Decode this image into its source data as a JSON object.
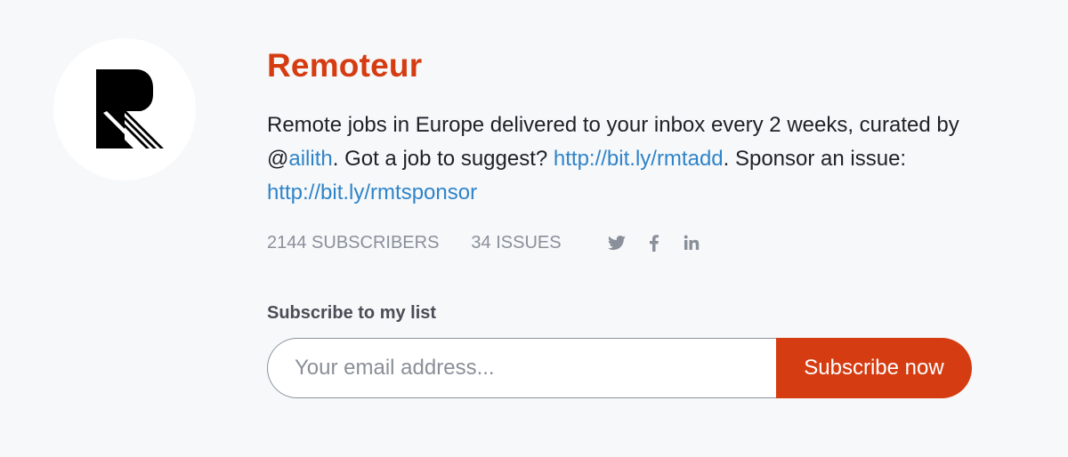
{
  "profile": {
    "name": "Remoteur",
    "description": {
      "part1": "Remote jobs in Europe delivered to your inbox every 2 weeks, curated by @",
      "handle_link": "ailith",
      "part2": ". Got a job to suggest? ",
      "link1": "http://bit.ly/rmtadd",
      "part3": ". Sponsor an issue: ",
      "link2": "http://bit.ly/rmtsponsor"
    },
    "stats": {
      "subscribers": "2144 SUBSCRIBERS",
      "issues": "34 ISSUES"
    },
    "social_icons": [
      "twitter-icon",
      "facebook-icon",
      "linkedin-icon"
    ]
  },
  "subscribe": {
    "label": "Subscribe to my list",
    "email_placeholder": "Your email address...",
    "email_value": "",
    "button_label": "Subscribe now"
  },
  "colors": {
    "brand": "#d53c11",
    "link": "#2f84c8",
    "muted": "#8a909a",
    "background": "#f7f8fa"
  }
}
